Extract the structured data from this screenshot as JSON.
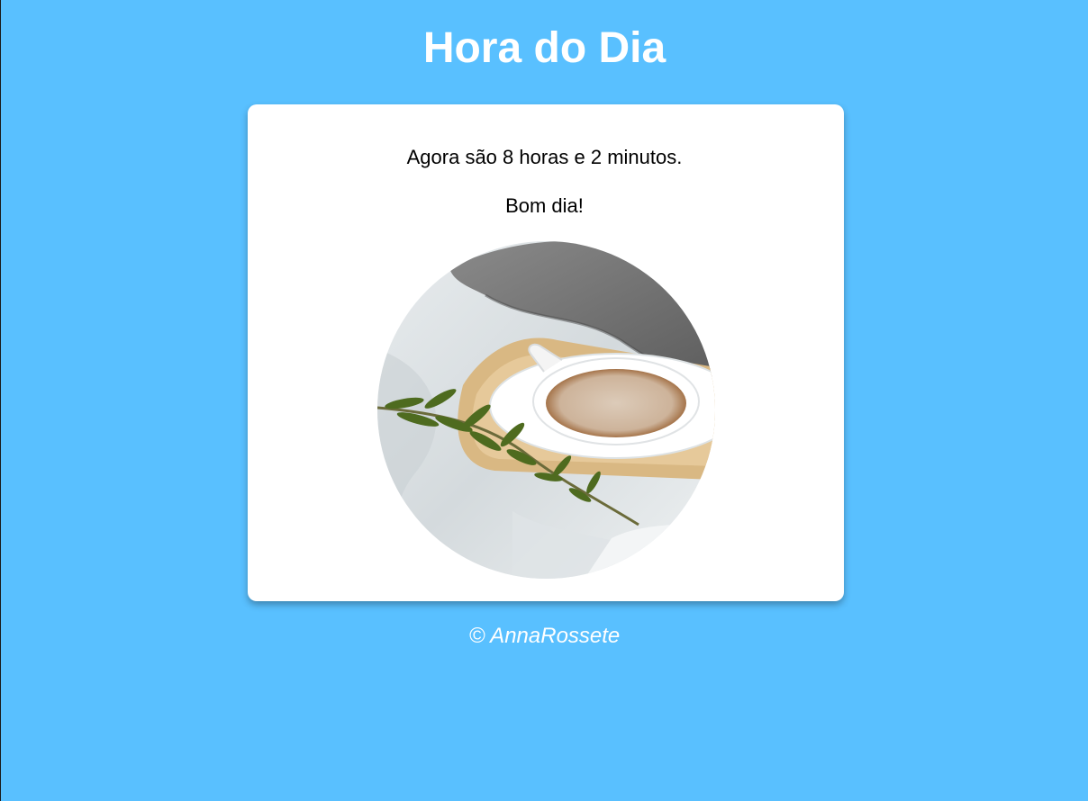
{
  "header": {
    "title": "Hora do Dia"
  },
  "card": {
    "time_message": "Agora são 8 horas e 2 minutos.",
    "greeting": "Bom dia!",
    "image_subject": "morning-coffee-photo"
  },
  "footer": {
    "copyright": "© AnnaRossete"
  },
  "colors": {
    "background": "#59c0ff",
    "card": "#ffffff",
    "title_text": "#ffffff",
    "body_text": "#000000"
  }
}
